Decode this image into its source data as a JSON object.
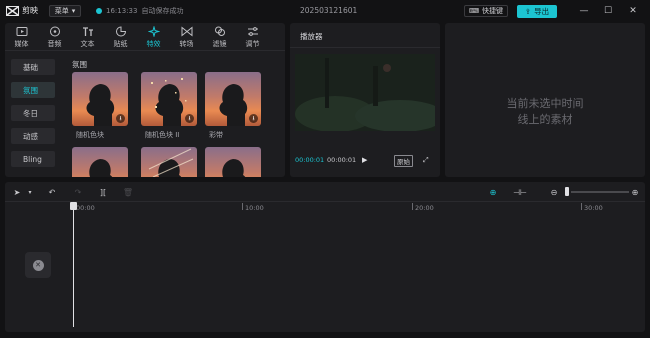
{
  "app": {
    "name": "剪映",
    "logo_icon": "scissors-logo-icon"
  },
  "titlebar": {
    "menu_label": "菜单",
    "save_time": "16:13:33",
    "save_status": "自动保存成功",
    "project_name": "202503121601",
    "shortcut_label": "快捷键",
    "export_label": "导出"
  },
  "colors": {
    "accent": "#1cc5d2",
    "panel": "#1d1d20",
    "background": "#121214"
  },
  "media": {
    "tabs": [
      {
        "label": "媒体",
        "icon": "media-icon"
      },
      {
        "label": "音频",
        "icon": "audio-icon"
      },
      {
        "label": "文本",
        "icon": "text-icon"
      },
      {
        "label": "贴纸",
        "icon": "sticker-icon"
      },
      {
        "label": "特效",
        "icon": "effects-icon",
        "active": true
      },
      {
        "label": "转场",
        "icon": "transition-icon"
      },
      {
        "label": "滤镜",
        "icon": "filter-icon"
      },
      {
        "label": "调节",
        "icon": "adjust-icon"
      }
    ],
    "categories": [
      {
        "label": "基础"
      },
      {
        "label": "氛围",
        "active": true
      },
      {
        "label": "冬日"
      },
      {
        "label": "动感"
      },
      {
        "label": "Bling"
      }
    ],
    "section_title": "氛围",
    "items": [
      {
        "label": "随机色块"
      },
      {
        "label": "随机色块 II"
      },
      {
        "label": "彩带"
      },
      {
        "label": ""
      },
      {
        "label": ""
      },
      {
        "label": ""
      }
    ]
  },
  "player": {
    "title": "播放器",
    "current_time": "00:00:01",
    "total_time": "00:00:01",
    "original_label": "原始"
  },
  "properties": {
    "empty_line1": "当前未选中时间",
    "empty_line2": "线上的素材"
  },
  "timeline": {
    "ruler": [
      "00:00",
      "10:00",
      "20:00",
      "30:00"
    ]
  }
}
